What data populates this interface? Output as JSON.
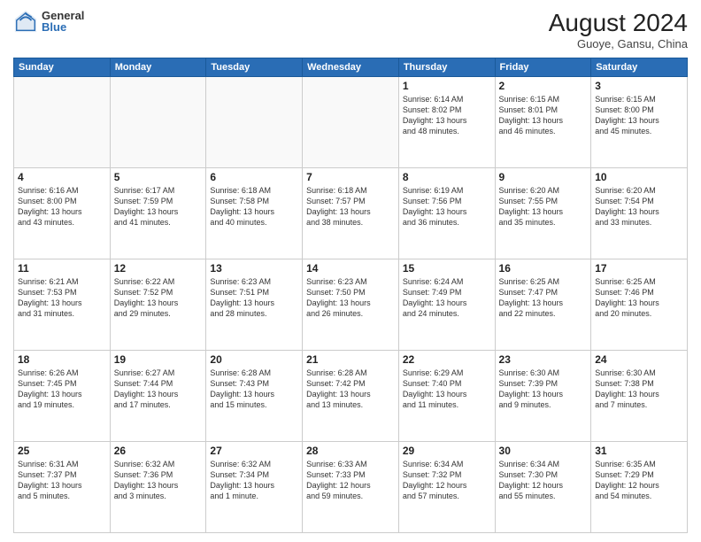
{
  "header": {
    "logo_general": "General",
    "logo_blue": "Blue",
    "month_title": "August 2024",
    "location": "Guoye, Gansu, China"
  },
  "weekdays": [
    "Sunday",
    "Monday",
    "Tuesday",
    "Wednesday",
    "Thursday",
    "Friday",
    "Saturday"
  ],
  "weeks": [
    [
      {
        "day": "",
        "info": ""
      },
      {
        "day": "",
        "info": ""
      },
      {
        "day": "",
        "info": ""
      },
      {
        "day": "",
        "info": ""
      },
      {
        "day": "1",
        "info": "Sunrise: 6:14 AM\nSunset: 8:02 PM\nDaylight: 13 hours\nand 48 minutes."
      },
      {
        "day": "2",
        "info": "Sunrise: 6:15 AM\nSunset: 8:01 PM\nDaylight: 13 hours\nand 46 minutes."
      },
      {
        "day": "3",
        "info": "Sunrise: 6:15 AM\nSunset: 8:00 PM\nDaylight: 13 hours\nand 45 minutes."
      }
    ],
    [
      {
        "day": "4",
        "info": "Sunrise: 6:16 AM\nSunset: 8:00 PM\nDaylight: 13 hours\nand 43 minutes."
      },
      {
        "day": "5",
        "info": "Sunrise: 6:17 AM\nSunset: 7:59 PM\nDaylight: 13 hours\nand 41 minutes."
      },
      {
        "day": "6",
        "info": "Sunrise: 6:18 AM\nSunset: 7:58 PM\nDaylight: 13 hours\nand 40 minutes."
      },
      {
        "day": "7",
        "info": "Sunrise: 6:18 AM\nSunset: 7:57 PM\nDaylight: 13 hours\nand 38 minutes."
      },
      {
        "day": "8",
        "info": "Sunrise: 6:19 AM\nSunset: 7:56 PM\nDaylight: 13 hours\nand 36 minutes."
      },
      {
        "day": "9",
        "info": "Sunrise: 6:20 AM\nSunset: 7:55 PM\nDaylight: 13 hours\nand 35 minutes."
      },
      {
        "day": "10",
        "info": "Sunrise: 6:20 AM\nSunset: 7:54 PM\nDaylight: 13 hours\nand 33 minutes."
      }
    ],
    [
      {
        "day": "11",
        "info": "Sunrise: 6:21 AM\nSunset: 7:53 PM\nDaylight: 13 hours\nand 31 minutes."
      },
      {
        "day": "12",
        "info": "Sunrise: 6:22 AM\nSunset: 7:52 PM\nDaylight: 13 hours\nand 29 minutes."
      },
      {
        "day": "13",
        "info": "Sunrise: 6:23 AM\nSunset: 7:51 PM\nDaylight: 13 hours\nand 28 minutes."
      },
      {
        "day": "14",
        "info": "Sunrise: 6:23 AM\nSunset: 7:50 PM\nDaylight: 13 hours\nand 26 minutes."
      },
      {
        "day": "15",
        "info": "Sunrise: 6:24 AM\nSunset: 7:49 PM\nDaylight: 13 hours\nand 24 minutes."
      },
      {
        "day": "16",
        "info": "Sunrise: 6:25 AM\nSunset: 7:47 PM\nDaylight: 13 hours\nand 22 minutes."
      },
      {
        "day": "17",
        "info": "Sunrise: 6:25 AM\nSunset: 7:46 PM\nDaylight: 13 hours\nand 20 minutes."
      }
    ],
    [
      {
        "day": "18",
        "info": "Sunrise: 6:26 AM\nSunset: 7:45 PM\nDaylight: 13 hours\nand 19 minutes."
      },
      {
        "day": "19",
        "info": "Sunrise: 6:27 AM\nSunset: 7:44 PM\nDaylight: 13 hours\nand 17 minutes."
      },
      {
        "day": "20",
        "info": "Sunrise: 6:28 AM\nSunset: 7:43 PM\nDaylight: 13 hours\nand 15 minutes."
      },
      {
        "day": "21",
        "info": "Sunrise: 6:28 AM\nSunset: 7:42 PM\nDaylight: 13 hours\nand 13 minutes."
      },
      {
        "day": "22",
        "info": "Sunrise: 6:29 AM\nSunset: 7:40 PM\nDaylight: 13 hours\nand 11 minutes."
      },
      {
        "day": "23",
        "info": "Sunrise: 6:30 AM\nSunset: 7:39 PM\nDaylight: 13 hours\nand 9 minutes."
      },
      {
        "day": "24",
        "info": "Sunrise: 6:30 AM\nSunset: 7:38 PM\nDaylight: 13 hours\nand 7 minutes."
      }
    ],
    [
      {
        "day": "25",
        "info": "Sunrise: 6:31 AM\nSunset: 7:37 PM\nDaylight: 13 hours\nand 5 minutes."
      },
      {
        "day": "26",
        "info": "Sunrise: 6:32 AM\nSunset: 7:36 PM\nDaylight: 13 hours\nand 3 minutes."
      },
      {
        "day": "27",
        "info": "Sunrise: 6:32 AM\nSunset: 7:34 PM\nDaylight: 13 hours\nand 1 minute."
      },
      {
        "day": "28",
        "info": "Sunrise: 6:33 AM\nSunset: 7:33 PM\nDaylight: 12 hours\nand 59 minutes."
      },
      {
        "day": "29",
        "info": "Sunrise: 6:34 AM\nSunset: 7:32 PM\nDaylight: 12 hours\nand 57 minutes."
      },
      {
        "day": "30",
        "info": "Sunrise: 6:34 AM\nSunset: 7:30 PM\nDaylight: 12 hours\nand 55 minutes."
      },
      {
        "day": "31",
        "info": "Sunrise: 6:35 AM\nSunset: 7:29 PM\nDaylight: 12 hours\nand 54 minutes."
      }
    ]
  ]
}
